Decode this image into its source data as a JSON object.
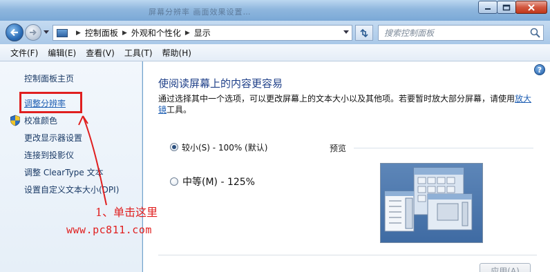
{
  "window": {
    "title": "屏幕分辨率 画面效果设置…",
    "controls": [
      "minimize-icon",
      "maximize-icon",
      "close-icon"
    ]
  },
  "address": {
    "breadcrumbs": [
      "控制面板",
      "外观和个性化",
      "显示"
    ],
    "search_placeholder": "搜索控制面板"
  },
  "menu": [
    "文件(F)",
    "编辑(E)",
    "查看(V)",
    "工具(T)",
    "帮助(H)"
  ],
  "sidebar": {
    "home": "控制面板主页",
    "items": [
      {
        "label": "调整分辨率"
      },
      {
        "label": "校准颜色",
        "icon": "shield-icon"
      },
      {
        "label": "更改显示器设置"
      },
      {
        "label": "连接到投影仪"
      },
      {
        "label": "调整 ClearType 文本"
      },
      {
        "label": "设置自定义文本大小(DPI)"
      }
    ]
  },
  "main": {
    "title": "使阅读屏幕上的内容更容易",
    "description_prefix": "通过选择其中一个选项，可以更改屏幕上的文本大小以及其他项。若要暂时放大部分屏幕，请使用",
    "description_link": "放大镜",
    "description_suffix": "工具。",
    "options": [
      {
        "label": "较小(S) - 100% (默认)",
        "selected": true
      },
      {
        "label": "中等(M) - 125%",
        "selected": false
      }
    ],
    "preview_label": "预览",
    "apply_label": "应用(A)"
  },
  "annotation": {
    "instruction": "1、单击这里",
    "url": "www.pc811.com",
    "color": "#e01f1f"
  }
}
